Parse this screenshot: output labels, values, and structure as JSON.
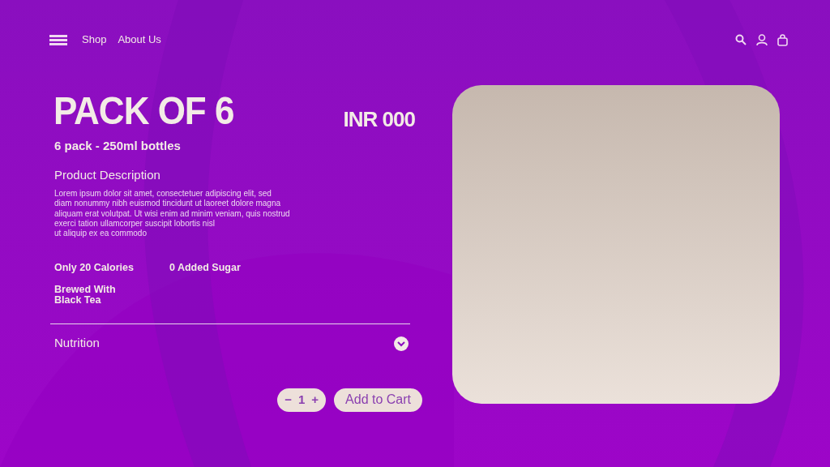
{
  "nav": {
    "links": [
      "Shop",
      "About Us"
    ]
  },
  "product": {
    "title": "PACK OF 6",
    "price": "INR 000",
    "subtitle": "6 pack - 250ml bottles",
    "description_heading": "Product Description",
    "description": [
      "Lorem ipsum dolor sit amet, consectetuer adipiscing elit, sed",
      "diam nonummy nibh euismod tincidunt ut laoreet dolore magna",
      "aliquam erat volutpat. Ut wisi enim ad minim veniam, quis nostrud",
      "exerci tation ullamcorper suscipit lobortis nisl",
      "ut aliquip ex ea commodo"
    ],
    "features": [
      "Only 20 Calories",
      "0 Added Sugar",
      "Brewed With\nBlack Tea"
    ]
  },
  "nutrition": {
    "label": "Nutrition",
    "expanded": false
  },
  "cart": {
    "decrement": "−",
    "quantity": "1",
    "increment": "+",
    "button": "Add to Cart"
  }
}
